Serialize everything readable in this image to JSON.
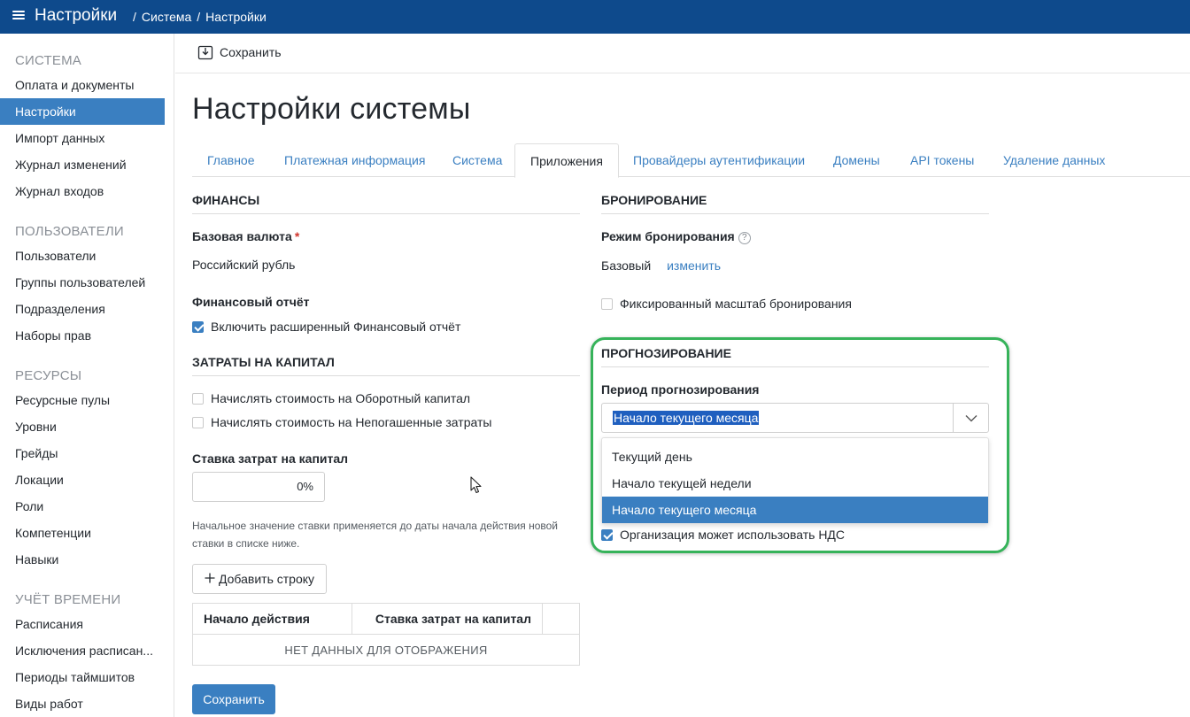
{
  "topbar": {
    "title": "Настройки",
    "breadcrumb": [
      "/",
      "Система",
      "/",
      "Настройки"
    ]
  },
  "sidebar": {
    "groups": [
      {
        "title": "СИСТЕМА",
        "items": [
          "Оплата и документы",
          "Настройки",
          "Импорт данных",
          "Журнал изменений",
          "Журнал входов"
        ]
      },
      {
        "title": "ПОЛЬЗОВАТЕЛИ",
        "items": [
          "Пользователи",
          "Группы пользователей",
          "Подразделения",
          "Наборы прав"
        ]
      },
      {
        "title": "РЕСУРСЫ",
        "items": [
          "Ресурсные пулы",
          "Уровни",
          "Грейды",
          "Локации",
          "Роли",
          "Компетенции",
          "Навыки"
        ]
      },
      {
        "title": "УЧЁТ ВРЕМЕНИ",
        "items": [
          "Расписания",
          "Исключения расписан...",
          "Периоды таймшитов",
          "Виды работ"
        ]
      }
    ],
    "active_item": "Настройки"
  },
  "toolbar": {
    "save_label": "Сохранить"
  },
  "page": {
    "title": "Настройки системы"
  },
  "tabs": [
    "Главное",
    "Платежная информация",
    "Система",
    "Приложения",
    "Провайдеры аутентификации",
    "Домены",
    "API токены",
    "Удаление данных"
  ],
  "active_tab": "Приложения",
  "finance": {
    "section_title": "ФИНАНСЫ",
    "currency_label": "Базовая валюта",
    "required_mark": "*",
    "currency_value": "Российский рубль",
    "report_label": "Финансовый отчёт",
    "report_checkbox": "Включить расширенный Финансовый отчёт",
    "report_checked": true
  },
  "capital": {
    "section_title": "ЗАТРАТЫ НА КАПИТАЛ",
    "working_capital": "Начислять стоимость на Оборотный капитал",
    "working_capital_checked": false,
    "outstanding": "Начислять стоимость на Непогашенные затраты",
    "outstanding_checked": false,
    "rate_label": "Ставка затрат на капитал",
    "rate_value": "0%",
    "hint": "Начальное значение ставки применяется до даты начала действия новой ставки в списке ниже.",
    "add_row": "Добавить строку",
    "table": {
      "col_start": "Начало действия",
      "col_rate": "Ставка затрат на капитал",
      "empty": "НЕТ ДАННЫХ ДЛЯ ОТОБРАЖЕНИЯ"
    },
    "save_button": "Сохранить"
  },
  "booking": {
    "section_title": "БРОНИРОВАНИЕ",
    "mode_label": "Режим бронирования",
    "help_icon": "?",
    "mode_value": "Базовый",
    "change_link": "изменить",
    "fixed_scale": "Фиксированный масштаб бронирования",
    "fixed_scale_checked": false
  },
  "forecast": {
    "section_title": "ПРОГНОЗИРОВАНИЕ",
    "period_label": "Период прогнозирования",
    "selected": "Начало текущего месяца",
    "options": [
      "Текущий день",
      "Начало текущей недели",
      "Начало текущего месяца"
    ],
    "vat_checkbox": "Организация может использовать НДС",
    "vat_checked": true
  },
  "colors": {
    "topbar": "#0e4a8c",
    "accent": "#3a7fc1",
    "highlight": "#36b35a"
  }
}
